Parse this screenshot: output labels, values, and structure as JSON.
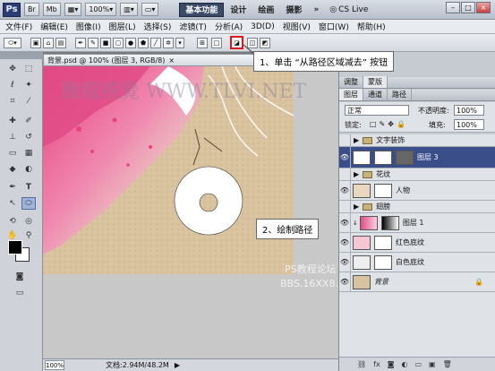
{
  "app": {
    "logo": "Ps",
    "zoom_select": "100%",
    "workspaces": [
      "基本功能",
      "设计",
      "绘画",
      "摄影"
    ],
    "active_workspace": "基本功能",
    "more": "»",
    "cslive": "CS Live"
  },
  "menu": [
    "文件(F)",
    "编辑(E)",
    "图像(I)",
    "图层(L)",
    "选择(S)",
    "滤镜(T)",
    "分析(A)",
    "3D(D)",
    "视图(V)",
    "窗口(W)",
    "帮助(H)"
  ],
  "document": {
    "tab_title": "背景.psd @ 100% (图层 3, RGB/8)",
    "zoom": "100%",
    "doc_size": "文档:2.94M/48.2M",
    "watermark": "騰龍視覺 WWW.TLVI.NET",
    "watermark2": "PS教程论坛",
    "watermark3": "BBS.16XX8.COM"
  },
  "callouts": {
    "step1": "1、单击 “从路径区域减去” 按钮",
    "step2": "2、绘制路径"
  },
  "panels": {
    "tabs_top": [
      "调整",
      "蒙版"
    ],
    "tabs_layers": [
      "图层",
      "通道",
      "路径"
    ],
    "blend_mode": "正常",
    "opacity_label": "不透明度:",
    "opacity_value": "100%",
    "lock_label": "锁定:",
    "fill_label": "填充:",
    "fill_value": "100%",
    "layers": [
      {
        "name": "文字装饰",
        "kind": "group",
        "visible": false
      },
      {
        "name": "图层 3",
        "kind": "layer",
        "visible": true,
        "selected": true
      },
      {
        "name": "花纹",
        "kind": "group",
        "visible": false
      },
      {
        "name": "人物",
        "kind": "layer",
        "visible": true
      },
      {
        "name": "翅膀",
        "kind": "group",
        "visible": false
      },
      {
        "name": "图层 1",
        "kind": "layer",
        "visible": true
      },
      {
        "name": "红色底纹",
        "kind": "layer",
        "visible": true
      },
      {
        "name": "白色底纹",
        "kind": "layer",
        "visible": true
      },
      {
        "name": "背景",
        "kind": "layer",
        "visible": true
      }
    ]
  },
  "colors": {
    "accent_red": "#e0151c",
    "layer_selected": "#3a4f8a",
    "sand": "#d8c3a0",
    "pink": "#e6508c"
  }
}
